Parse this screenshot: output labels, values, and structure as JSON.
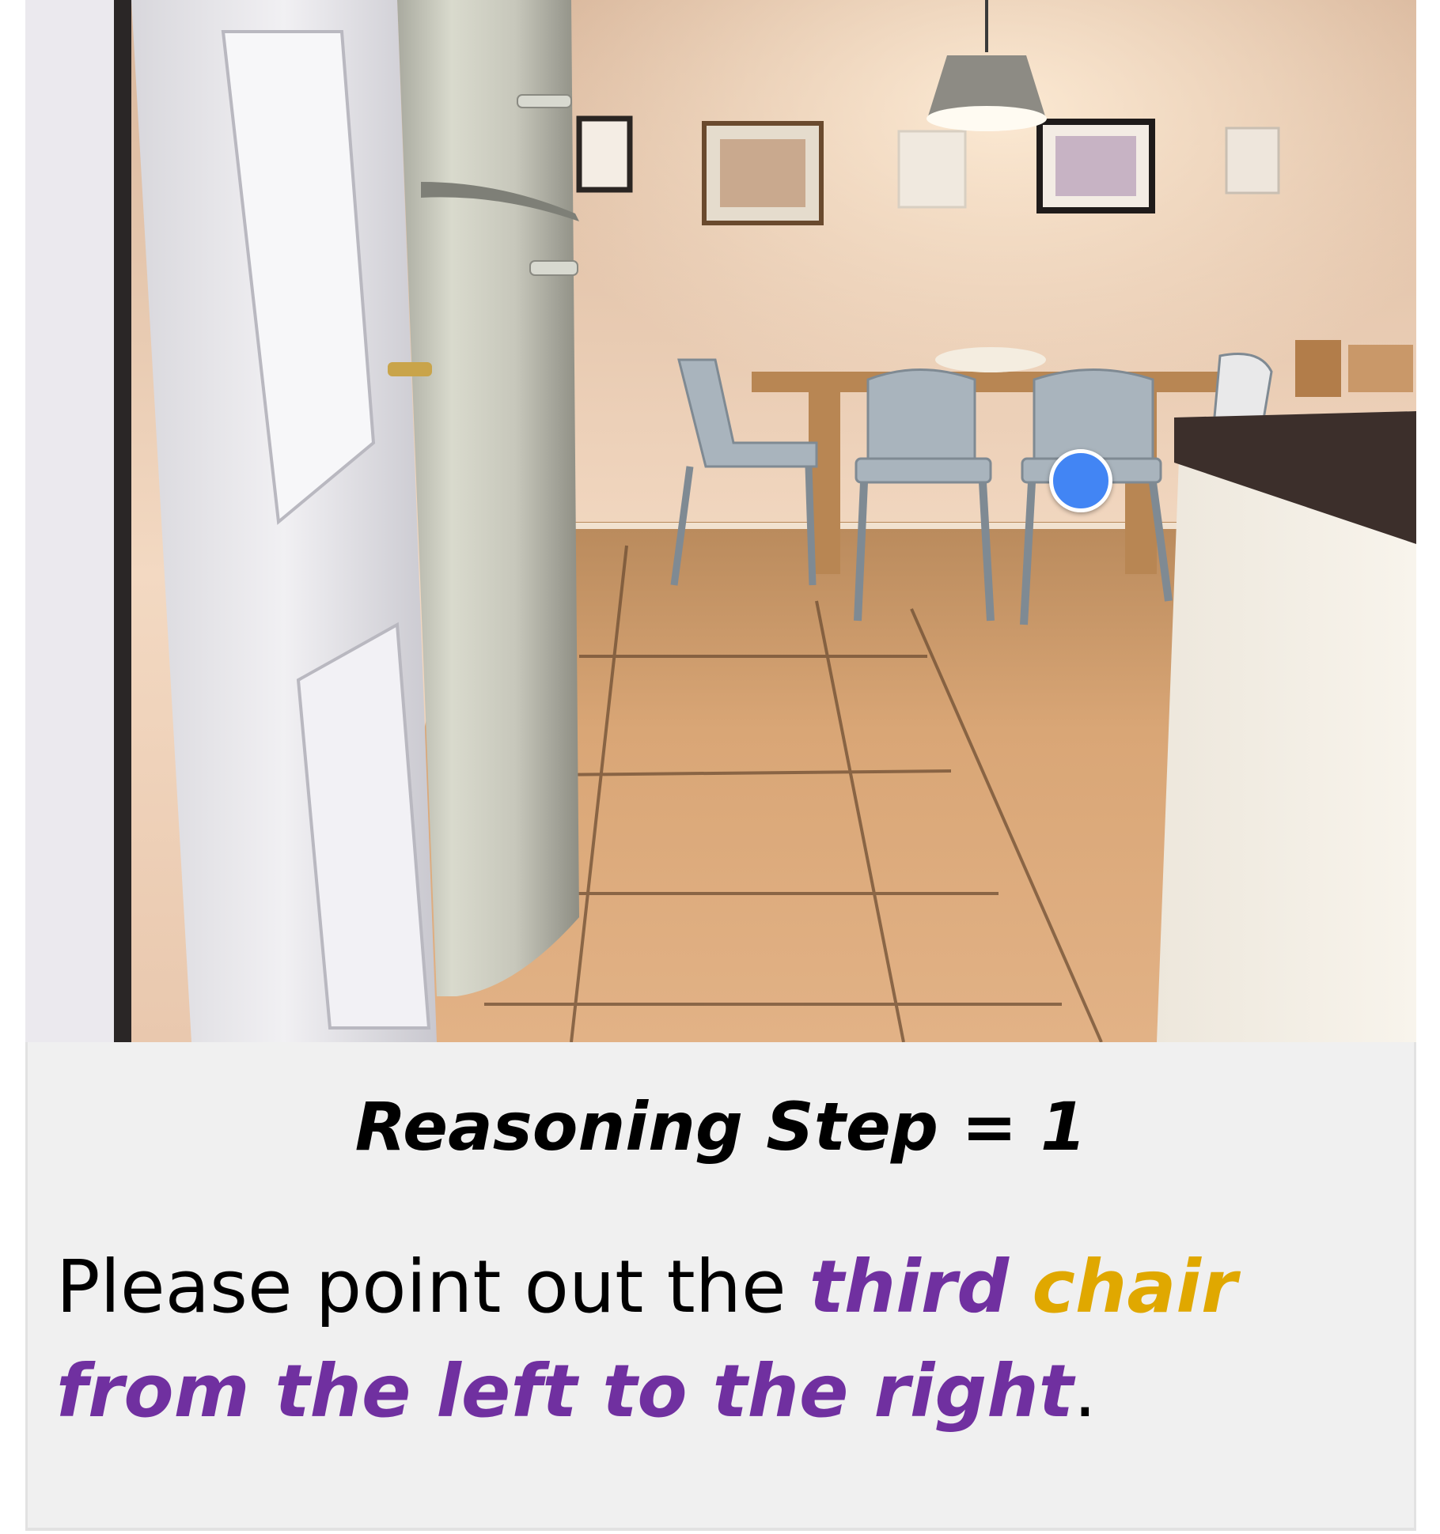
{
  "panel": {
    "step_title": "Reasoning Step = 1",
    "instruction_prefix": "Please point out the ",
    "instruction_highlight_1": "third",
    "instruction_gap_1": " ",
    "instruction_object": "chair",
    "instruction_gap_2": " ",
    "instruction_highlight_2": "from the left to the right",
    "instruction_suffix": "."
  },
  "colors": {
    "highlight_purple": "#7030a0",
    "object_gold": "#e0a800",
    "marker_blue": "#4285f4",
    "panel_background": "#f0f0f0"
  },
  "marker": {
    "icon": "point-marker-dot"
  }
}
